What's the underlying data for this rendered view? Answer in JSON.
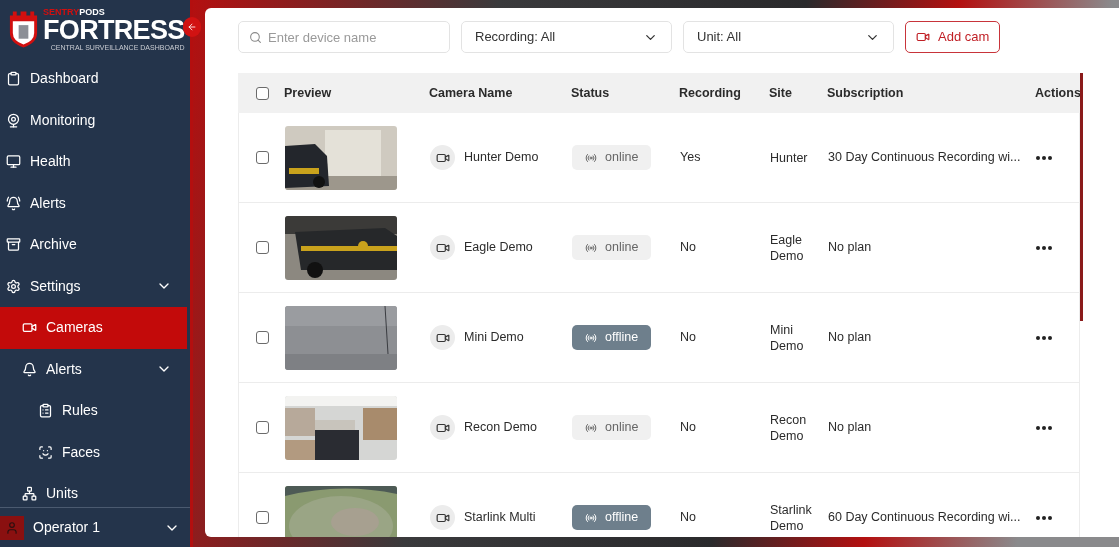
{
  "brand": {
    "prefix": "SENTRY",
    "suffix": "PODS",
    "name": "FORTRESS",
    "tagline": "CENTRAL SURVEILLANCE DASHBOARD"
  },
  "sidebar": {
    "items": [
      {
        "label": "Dashboard",
        "selected": false
      },
      {
        "label": "Monitoring",
        "selected": false
      },
      {
        "label": "Health",
        "selected": false
      },
      {
        "label": "Alerts",
        "selected": false
      },
      {
        "label": "Archive",
        "selected": false
      },
      {
        "label": "Settings",
        "selected": false,
        "expanded": true,
        "children": [
          {
            "label": "Cameras",
            "selected": true
          },
          {
            "label": "Alerts",
            "selected": false,
            "expanded": true,
            "children": [
              {
                "label": "Rules",
                "selected": false
              },
              {
                "label": "Faces",
                "selected": false
              }
            ]
          },
          {
            "label": "Units",
            "selected": false
          }
        ]
      }
    ],
    "user": {
      "name": "Operator 1",
      "expanded": false
    }
  },
  "filters": {
    "search": {
      "placeholder": "Enter device name"
    },
    "recording": "Recording: All",
    "unit": "Unit: All",
    "add_button": "Add cam"
  },
  "table": {
    "select_all": {
      "checked": false
    },
    "columns": [
      "Preview",
      "Camera Name",
      "Status",
      "Recording",
      "Site",
      "Subscription",
      "Actions"
    ],
    "rows": [
      {
        "checked": false,
        "name": "Hunter Demo",
        "status": "online",
        "online": true,
        "recording": "Yes",
        "site": "Hunter",
        "subscription": "30 Day Continuous Recording wi..."
      },
      {
        "checked": false,
        "name": "Eagle Demo",
        "status": "online",
        "online": true,
        "recording": "No",
        "site": "Eagle Demo",
        "subscription": "No plan"
      },
      {
        "checked": false,
        "name": "Mini Demo",
        "status": "offline",
        "online": false,
        "recording": "No",
        "site": "Mini Demo",
        "subscription": "No plan"
      },
      {
        "checked": false,
        "name": "Recon Demo",
        "status": "online",
        "online": true,
        "recording": "No",
        "site": "Recon Demo",
        "subscription": "No plan"
      },
      {
        "checked": false,
        "name": "Starlink Multi",
        "status": "offline",
        "online": false,
        "recording": "No",
        "site": "Starlink Demo",
        "subscription": "60 Day Continuous Recording wi..."
      }
    ]
  }
}
